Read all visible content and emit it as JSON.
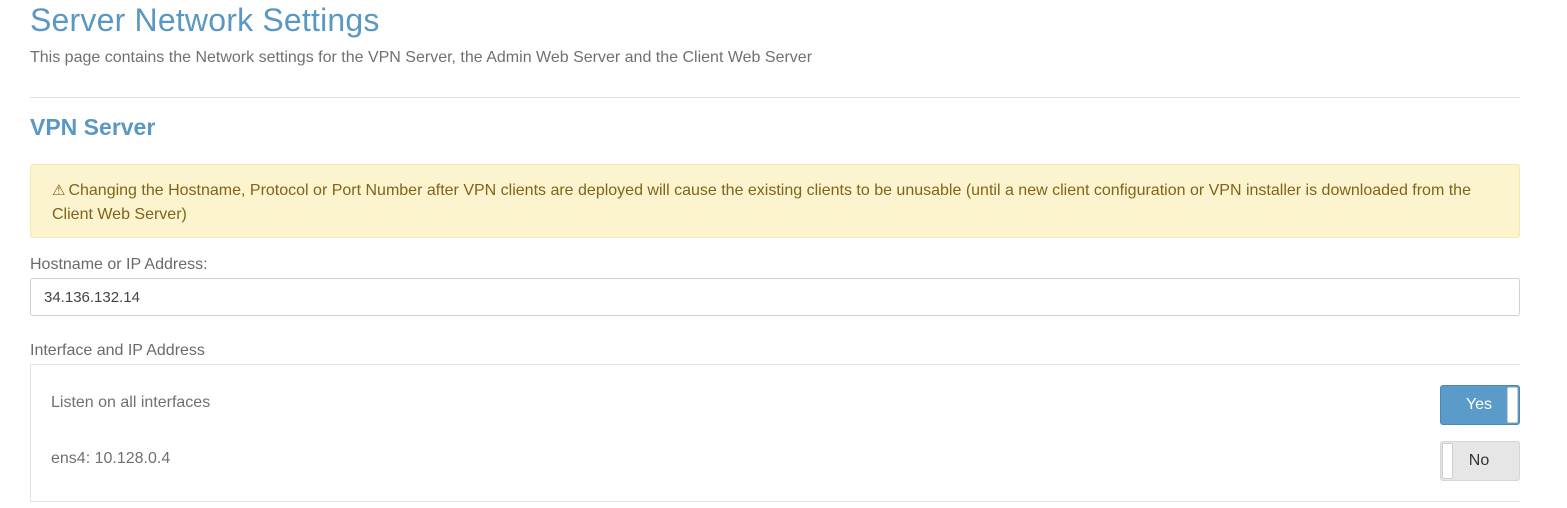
{
  "header": {
    "title": "Server Network Settings",
    "subtitle": "This page contains the Network settings for the VPN Server, the Admin Web Server and the Client Web Server"
  },
  "vpn_section": {
    "title": "VPN Server",
    "warning": {
      "icon": "warning-triangle-icon",
      "icon_glyph": "⚠",
      "text": "Changing the Hostname, Protocol or Port Number after VPN clients are deployed will cause the existing clients to be unusable (until a new client configuration or VPN installer is downloaded from the Client Web Server)"
    },
    "hostname": {
      "label": "Hostname or IP Address:",
      "value": "34.136.132.14"
    },
    "interface": {
      "label": "Interface and IP Address",
      "rows": [
        {
          "label": "Listen on all interfaces",
          "toggle": "Yes",
          "on": true
        },
        {
          "label": "ens4: 10.128.0.4",
          "toggle": "No",
          "on": false
        }
      ]
    }
  },
  "colors": {
    "title": "#5a98c4",
    "warning_bg": "#fcf3cf",
    "warning_text": "#806419",
    "toggle_on": "#5b9bc9",
    "toggle_off": "#e6e6e6"
  }
}
